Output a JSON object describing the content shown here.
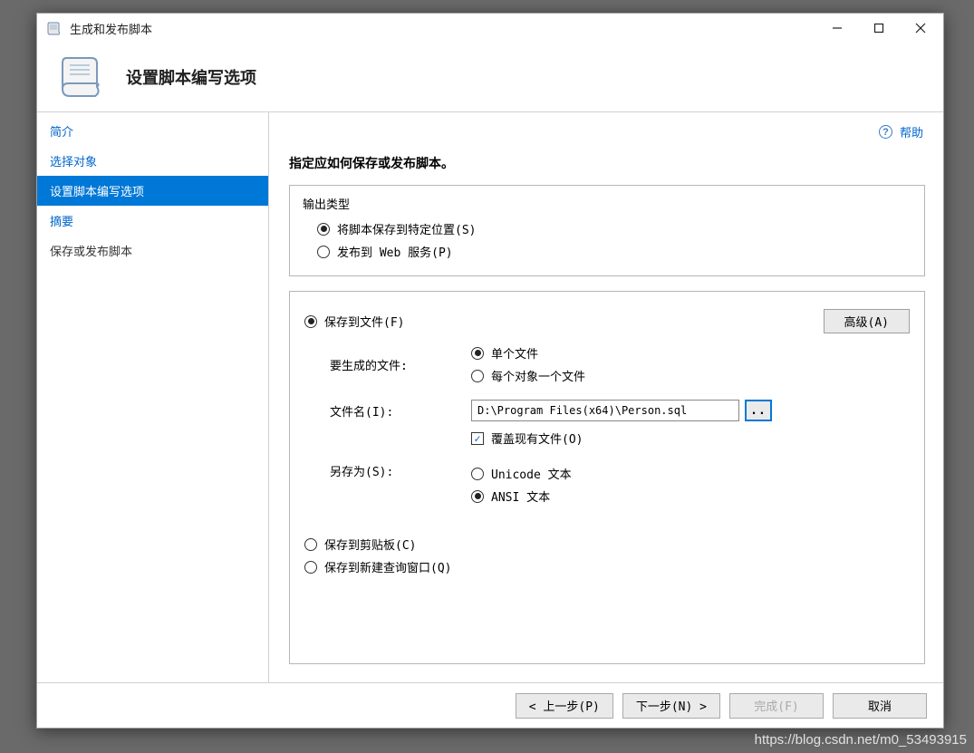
{
  "window": {
    "title": "生成和发布脚本"
  },
  "header": {
    "title": "设置脚本编写选项"
  },
  "help": {
    "label": "帮助"
  },
  "sidebar": {
    "items": [
      {
        "label": "简介",
        "active": false,
        "link": true
      },
      {
        "label": "选择对象",
        "active": false,
        "link": true
      },
      {
        "label": "设置脚本编写选项",
        "active": true,
        "link": false
      },
      {
        "label": "摘要",
        "active": false,
        "link": true
      },
      {
        "label": "保存或发布脚本",
        "active": false,
        "link": false
      }
    ]
  },
  "content": {
    "instruction": "指定应如何保存或发布脚本。",
    "output_type": {
      "legend": "输出类型",
      "save_location_label": "将脚本保存到特定位置(S)",
      "publish_web_label": "发布到 Web 服务(P)"
    },
    "save_to_file": {
      "label": "保存到文件(F)",
      "advanced_label": "高级(A)",
      "files_to_generate_label": "要生成的文件:",
      "single_file_label": "单个文件",
      "per_object_label": "每个对象一个文件",
      "filename_label": "文件名(I):",
      "filename_value": "D:\\Program Files(x64)\\Person.sql",
      "browse_label": "..",
      "overwrite_label": "覆盖现有文件(O)",
      "save_as_label": "另存为(S):",
      "unicode_label": "Unicode 文本",
      "ansi_label": "ANSI 文本"
    },
    "save_to_clipboard_label": "保存到剪贴板(C)",
    "save_to_query_label": "保存到新建查询窗口(Q)"
  },
  "footer": {
    "prev": "< 上一步(P)",
    "next": "下一步(N) >",
    "finish": "完成(F)",
    "cancel": "取消"
  },
  "watermark": "https://blog.csdn.net/m0_53493915"
}
